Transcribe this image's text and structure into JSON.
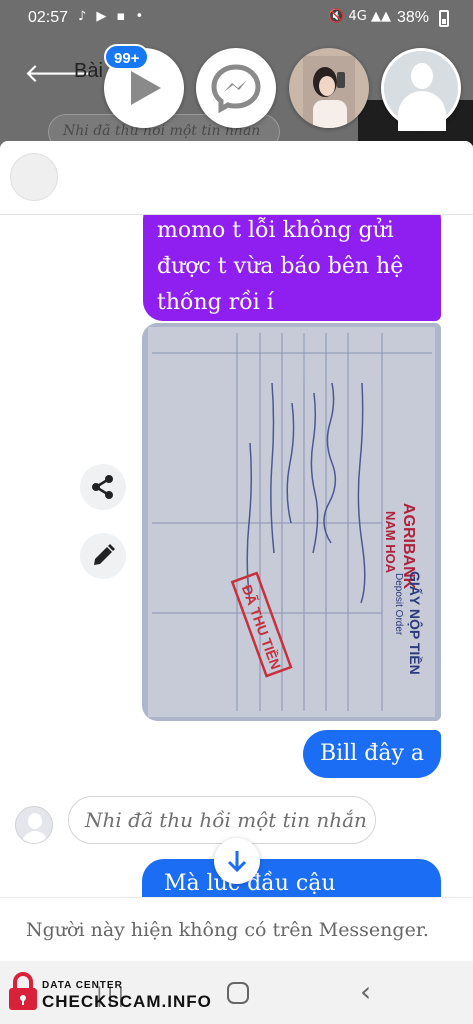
{
  "status_bar": {
    "time": "02:57",
    "left_icons": "tiktok youtube momo •",
    "signal_text": "4G",
    "battery": "38%"
  },
  "background_chat": {
    "title": "Bài",
    "recall_notice": "Nhi đã thu hồi một tin nhắn"
  },
  "chat_heads": {
    "unread_badge": "99+"
  },
  "messages": {
    "purple_text": "momo t lỗi không gửi được t vừa báo bên hệ thống rồi í",
    "bill_text": "Bill đây a",
    "recall_text": "Nhi đã thu hồi một tin nhắn",
    "partial_text": "Mà lúc đầu cậu"
  },
  "photo_receipt": {
    "bank": "AGRIBANK",
    "branch": "NAM HOA",
    "doc_title": "GIẤY NỘP TIỀN",
    "doc_subtitle": "Deposit Order",
    "stamp": "ĐÃ THU TIỀN"
  },
  "footer": {
    "notice": "Người này hiện không có trên Messenger."
  },
  "watermark": {
    "top": "DATA CENTER",
    "main": "CHECKSCAM.INFO"
  },
  "colors": {
    "purple_bubble": "#8f1ff0",
    "blue_bubble": "#1b6ef3",
    "badge": "#1877f2"
  }
}
